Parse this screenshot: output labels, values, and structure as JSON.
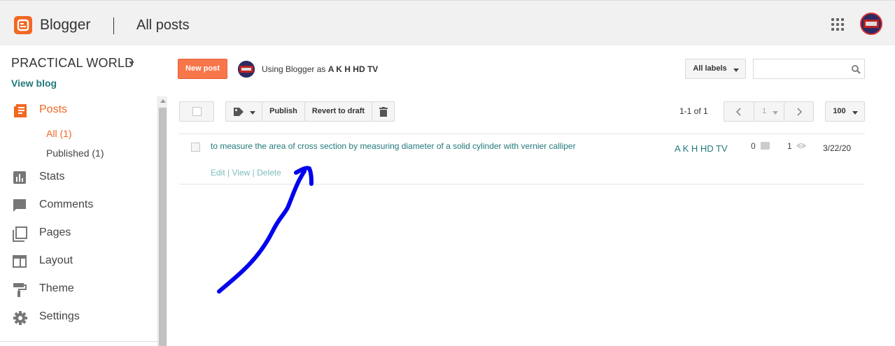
{
  "header": {
    "brand": "Blogger",
    "page_title": "All posts"
  },
  "blog": {
    "name": "PRACTICAL WORLD",
    "view_blog": "View blog"
  },
  "sidebar": {
    "items": [
      {
        "label": "Posts",
        "icon": "posts-icon",
        "active": true
      },
      {
        "label": "Stats",
        "icon": "stats-icon"
      },
      {
        "label": "Comments",
        "icon": "comments-icon"
      },
      {
        "label": "Pages",
        "icon": "pages-icon"
      },
      {
        "label": "Layout",
        "icon": "layout-icon"
      },
      {
        "label": "Theme",
        "icon": "theme-icon"
      },
      {
        "label": "Settings",
        "icon": "settings-icon"
      }
    ],
    "sub_items": [
      {
        "label": "All (1)",
        "active": true
      },
      {
        "label": "Published (1)"
      }
    ]
  },
  "toolbar": {
    "new_post": "New post",
    "using_as_prefix": "Using Blogger as",
    "user": "A K H HD TV",
    "all_labels": "All labels",
    "publish": "Publish",
    "revert": "Revert to draft",
    "range": "1-1 of 1",
    "page": "1",
    "per_page": "100"
  },
  "posts": [
    {
      "title": "to measure the area of cross section by measuring diameter of a solid cylinder with vernier calliper",
      "actions": {
        "edit": "Edit",
        "sep": "|",
        "view": "View",
        "delete": "Delete"
      },
      "author": "A K H HD TV",
      "comments": "0",
      "views": "1",
      "date": "3/22/20"
    }
  ],
  "colors": {
    "accent": "#f26722",
    "link": "#22797b",
    "annotation": "#0000ff"
  }
}
